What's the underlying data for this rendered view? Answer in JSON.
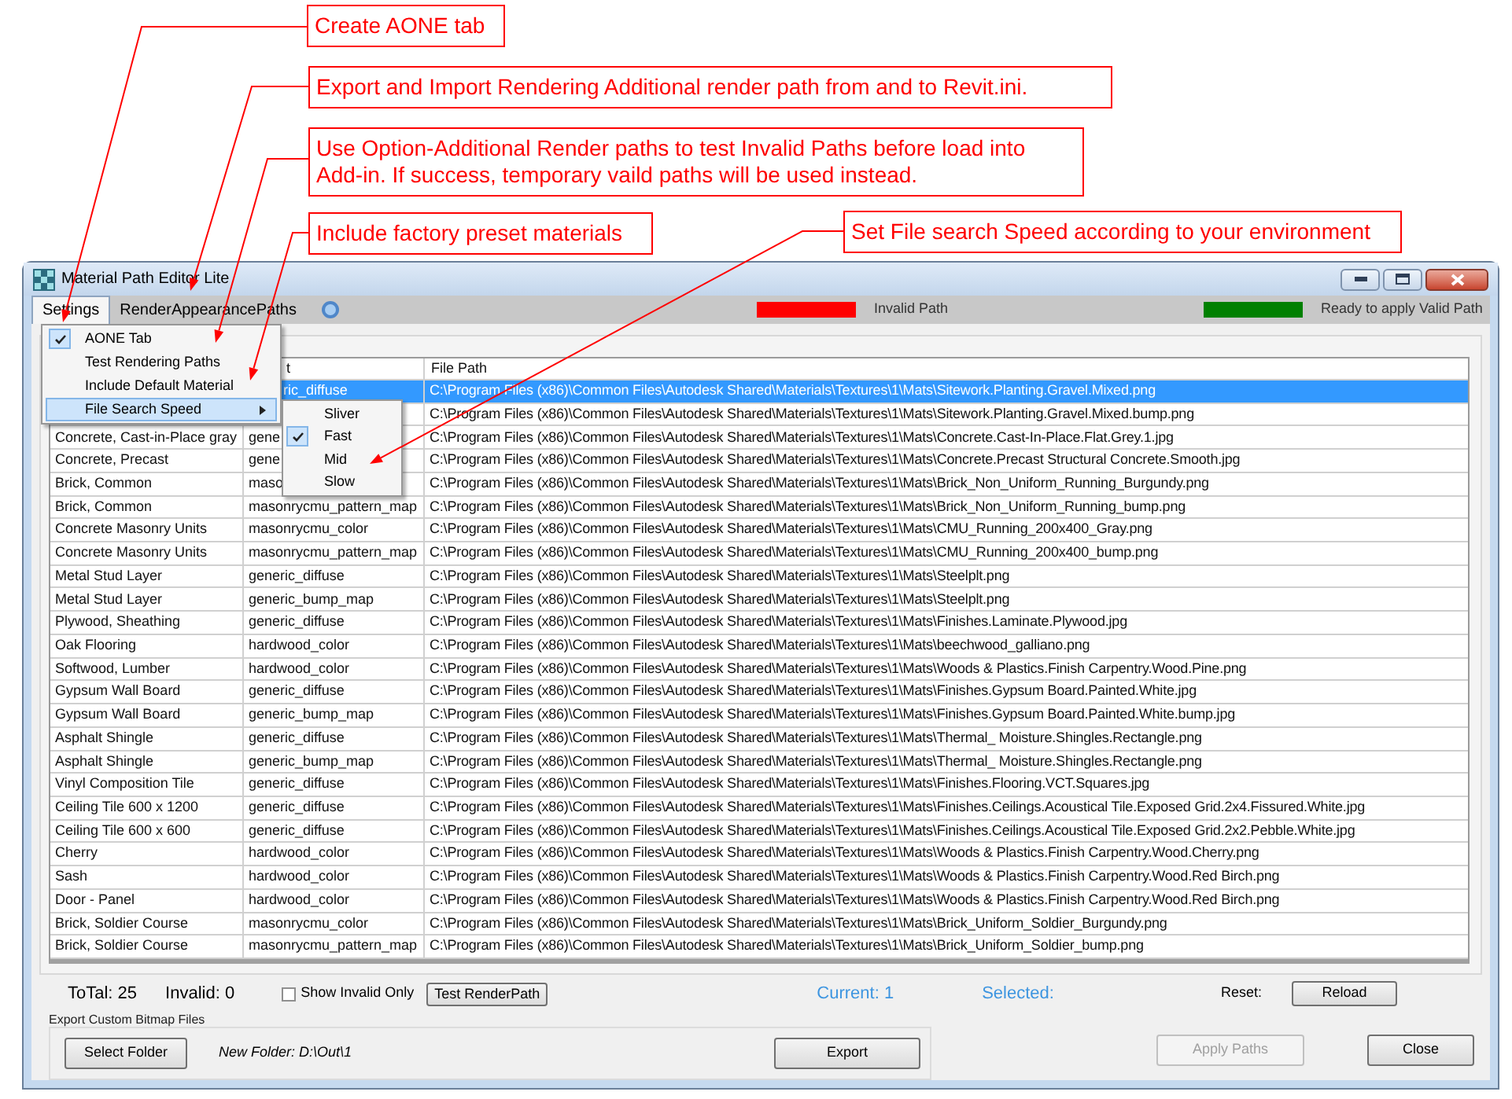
{
  "annotations": [
    {
      "text": "Create AONE tab"
    },
    {
      "text": "Export and Import Rendering Additional render path from and to Revit.ini."
    },
    {
      "text": "Use Option-Additional Render paths to test Invalid Paths before load into Add-in. If success, temporary vaild paths will be used instead."
    },
    {
      "text": "Include factory preset materials"
    },
    {
      "text": "Set File search Speed according to your environment"
    }
  ],
  "window": {
    "title": "Material Path Editor Lite"
  },
  "menu_bar": [
    {
      "label": "Settings",
      "selected": true
    },
    {
      "label": "RenderAppearancePaths",
      "selected": false
    }
  ],
  "legend": [
    {
      "label": "Invalid Path",
      "color": "#ff0000"
    },
    {
      "label": "Ready to apply Valid Path",
      "color": "#008000"
    }
  ],
  "settings_menu": [
    {
      "label": "AONE Tab",
      "checked": true,
      "selected": false,
      "kind": "item"
    },
    {
      "label": "Test Rendering Paths",
      "checked": false,
      "selected": false,
      "kind": "item"
    },
    {
      "label": "Include Default Material",
      "checked": false,
      "selected": false,
      "kind": "item"
    },
    {
      "label": "File Search Speed",
      "checked": false,
      "selected": true,
      "kind": "submenu"
    }
  ],
  "speed_menu": [
    {
      "label": "Sliver",
      "checked": false
    },
    {
      "label": "Fast",
      "checked": true
    },
    {
      "label": "Mid",
      "checked": false
    },
    {
      "label": "Slow",
      "checked": false
    }
  ],
  "table": {
    "columns": [
      {
        "label": "t"
      },
      {
        "label": "File Path"
      }
    ],
    "rows": [
      {
        "selected": true,
        "parameter": "ric_diffuse",
        "parameter_partly_hidden": true,
        "path": "C:\\Program Files (x86)\\Common Files\\Autodesk Shared\\Materials\\Textures\\1\\Mats\\Sitework.Planting.Gravel.Mixed.png"
      },
      {
        "selected": false,
        "path": "C:\\Program Files (x86)\\Common Files\\Autodesk Shared\\Materials\\Textures\\1\\Mats\\Sitework.Planting.Gravel.Mixed.bump.png"
      },
      {
        "selected": false,
        "material": "Concrete, Cast-in-Place gray",
        "parameter": "gene",
        "path": "C:\\Program Files (x86)\\Common Files\\Autodesk Shared\\Materials\\Textures\\1\\Mats\\Concrete.Cast-In-Place.Flat.Grey.1.jpg"
      },
      {
        "selected": false,
        "material": "Concrete, Precast",
        "parameter": "gene",
        "path": "C:\\Program Files (x86)\\Common Files\\Autodesk Shared\\Materials\\Textures\\1\\Mats\\Concrete.Precast Structural Concrete.Smooth.jpg"
      },
      {
        "selected": false,
        "material": "Brick, Common",
        "parameter": "maso",
        "path": "C:\\Program Files (x86)\\Common Files\\Autodesk Shared\\Materials\\Textures\\1\\Mats\\Brick_Non_Uniform_Running_Burgundy.png"
      },
      {
        "selected": false,
        "material": "Brick, Common",
        "parameter": "masonrycmu_pattern_map",
        "path": "C:\\Program Files (x86)\\Common Files\\Autodesk Shared\\Materials\\Textures\\1\\Mats\\Brick_Non_Uniform_Running_bump.png"
      },
      {
        "selected": false,
        "material": "Concrete Masonry Units",
        "parameter": "masonrycmu_color",
        "path": "C:\\Program Files (x86)\\Common Files\\Autodesk Shared\\Materials\\Textures\\1\\Mats\\CMU_Running_200x400_Gray.png"
      },
      {
        "selected": false,
        "material": "Concrete Masonry Units",
        "parameter": "masonrycmu_pattern_map",
        "path": "C:\\Program Files (x86)\\Common Files\\Autodesk Shared\\Materials\\Textures\\1\\Mats\\CMU_Running_200x400_bump.png"
      },
      {
        "selected": false,
        "material": "Metal Stud Layer",
        "parameter": "generic_diffuse",
        "path": "C:\\Program Files (x86)\\Common Files\\Autodesk Shared\\Materials\\Textures\\1\\Mats\\Steelplt.png"
      },
      {
        "selected": false,
        "material": "Metal Stud Layer",
        "parameter": "generic_bump_map",
        "path": "C:\\Program Files (x86)\\Common Files\\Autodesk Shared\\Materials\\Textures\\1\\Mats\\Steelplt.png"
      },
      {
        "selected": false,
        "material": "Plywood, Sheathing",
        "parameter": "generic_diffuse",
        "path": "C:\\Program Files (x86)\\Common Files\\Autodesk Shared\\Materials\\Textures\\1\\Mats\\Finishes.Laminate.Plywood.jpg"
      },
      {
        "selected": false,
        "material": "Oak Flooring",
        "parameter": "hardwood_color",
        "path": "C:\\Program Files (x86)\\Common Files\\Autodesk Shared\\Materials\\Textures\\1\\Mats\\beechwood_galliano.png"
      },
      {
        "selected": false,
        "material": "Softwood, Lumber",
        "parameter": "hardwood_color",
        "path": "C:\\Program Files (x86)\\Common Files\\Autodesk Shared\\Materials\\Textures\\1\\Mats\\Woods & Plastics.Finish Carpentry.Wood.Pine.png"
      },
      {
        "selected": false,
        "material": "Gypsum Wall Board",
        "parameter": "generic_diffuse",
        "path": "C:\\Program Files (x86)\\Common Files\\Autodesk Shared\\Materials\\Textures\\1\\Mats\\Finishes.Gypsum Board.Painted.White.jpg"
      },
      {
        "selected": false,
        "material": "Gypsum Wall Board",
        "parameter": "generic_bump_map",
        "path": "C:\\Program Files (x86)\\Common Files\\Autodesk Shared\\Materials\\Textures\\1\\Mats\\Finishes.Gypsum Board.Painted.White.bump.jpg"
      },
      {
        "selected": false,
        "material": "Asphalt Shingle",
        "parameter": "generic_diffuse",
        "path": "C:\\Program Files (x86)\\Common Files\\Autodesk Shared\\Materials\\Textures\\1\\Mats\\Thermal_ Moisture.Shingles.Rectangle.png"
      },
      {
        "selected": false,
        "material": "Asphalt Shingle",
        "parameter": "generic_bump_map",
        "path": "C:\\Program Files (x86)\\Common Files\\Autodesk Shared\\Materials\\Textures\\1\\Mats\\Thermal_ Moisture.Shingles.Rectangle.png"
      },
      {
        "selected": false,
        "material": "Vinyl Composition Tile",
        "parameter": "generic_diffuse",
        "path": "C:\\Program Files (x86)\\Common Files\\Autodesk Shared\\Materials\\Textures\\1\\Mats\\Finishes.Flooring.VCT.Squares.jpg"
      },
      {
        "selected": false,
        "material": "Ceiling Tile 600 x 1200",
        "parameter": "generic_diffuse",
        "path": "C:\\Program Files (x86)\\Common Files\\Autodesk Shared\\Materials\\Textures\\1\\Mats\\Finishes.Ceilings.Acoustical Tile.Exposed Grid.2x4.Fissured.White.jpg"
      },
      {
        "selected": false,
        "material": "Ceiling Tile 600 x 600",
        "parameter": "generic_diffuse",
        "path": "C:\\Program Files (x86)\\Common Files\\Autodesk Shared\\Materials\\Textures\\1\\Mats\\Finishes.Ceilings.Acoustical Tile.Exposed Grid.2x2.Pebble.White.jpg"
      },
      {
        "selected": false,
        "material": "Cherry",
        "parameter": "hardwood_color",
        "path": "C:\\Program Files (x86)\\Common Files\\Autodesk Shared\\Materials\\Textures\\1\\Mats\\Woods & Plastics.Finish Carpentry.Wood.Cherry.png"
      },
      {
        "selected": false,
        "material": "Sash",
        "parameter": "hardwood_color",
        "path": "C:\\Program Files (x86)\\Common Files\\Autodesk Shared\\Materials\\Textures\\1\\Mats\\Woods & Plastics.Finish Carpentry.Wood.Red Birch.png"
      },
      {
        "selected": false,
        "material": "Door - Panel",
        "parameter": "hardwood_color",
        "path": "C:\\Program Files (x86)\\Common Files\\Autodesk Shared\\Materials\\Textures\\1\\Mats\\Woods & Plastics.Finish Carpentry.Wood.Red Birch.png"
      },
      {
        "selected": false,
        "material": "Brick, Soldier Course",
        "parameter": "masonrycmu_color",
        "path": "C:\\Program Files (x86)\\Common Files\\Autodesk Shared\\Materials\\Textures\\1\\Mats\\Brick_Uniform_Soldier_Burgundy.png"
      },
      {
        "selected": false,
        "material": "Brick, Soldier Course",
        "parameter": "masonrycmu_pattern_map",
        "path": "C:\\Program Files (x86)\\Common Files\\Autodesk Shared\\Materials\\Textures\\1\\Mats\\Brick_Uniform_Soldier_bump.png"
      }
    ]
  },
  "footer": {
    "total": "ToTal: 25",
    "invalid": "Invalid: 0",
    "show_invalid_only": {
      "label": "Show Invalid Only",
      "checked": false
    },
    "test_button": "Test RenderPath",
    "current": "Current: 1",
    "selected": "Selected:",
    "reset_label": "Reset:",
    "reload_button": "Reload"
  },
  "export_group": {
    "title": "Export Custom Bitmap Files",
    "select_button": "Select Folder",
    "new_folder": "New Folder: D:\\Out\\1",
    "export_button": "Export"
  },
  "apply_button": {
    "label": "Apply Paths",
    "disabled": true
  },
  "close_button": "Close"
}
